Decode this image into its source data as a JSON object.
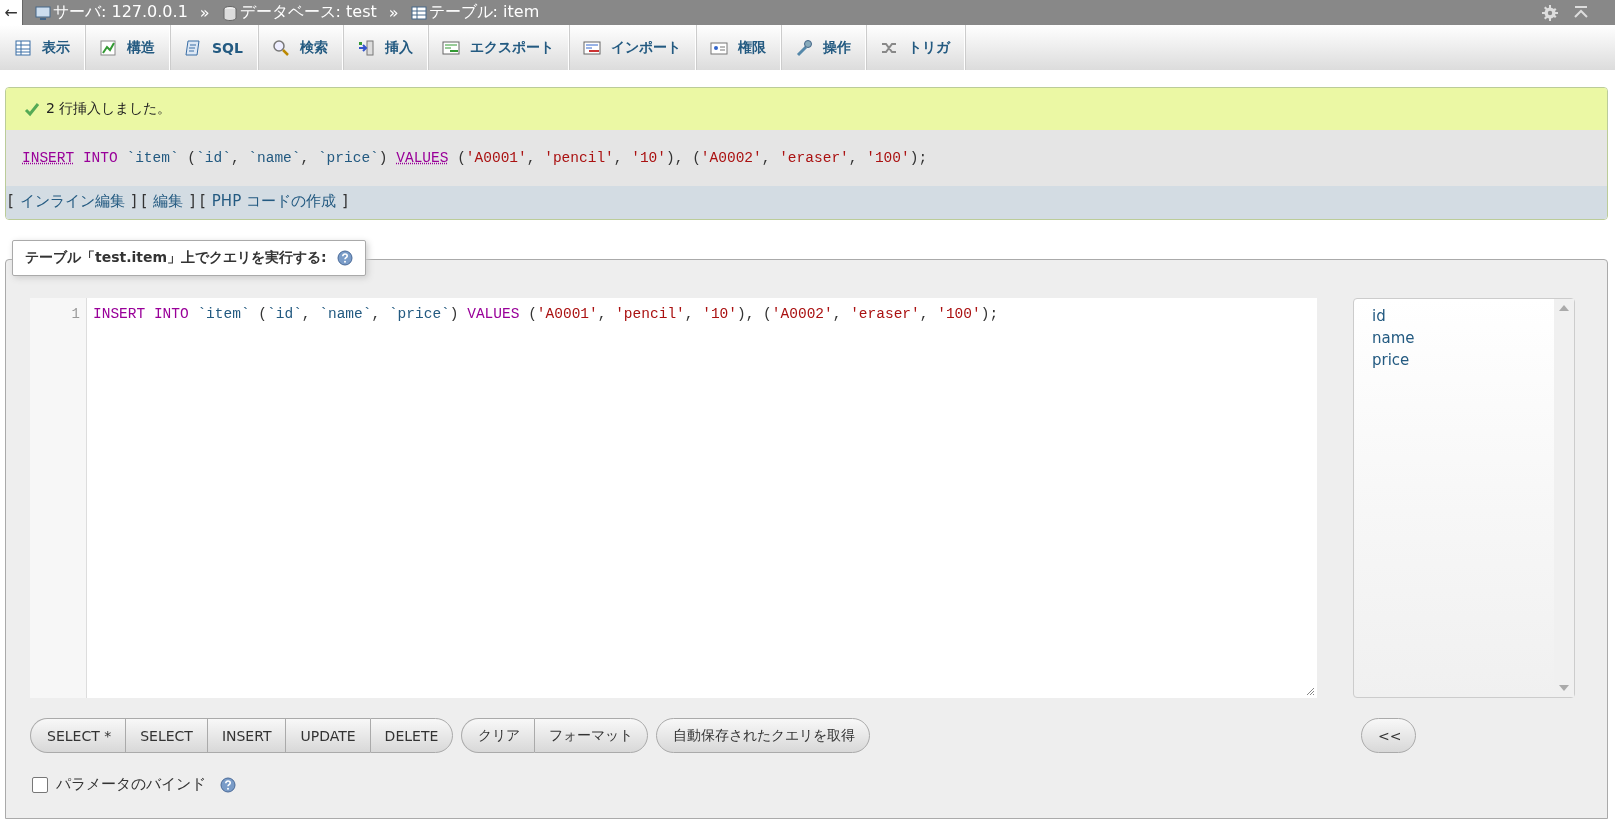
{
  "breadcrumb": {
    "back": "←",
    "items": [
      {
        "kind": "server",
        "text": "サーバ: 127.0.0.1"
      },
      {
        "kind": "database",
        "text": "データベース: test"
      },
      {
        "kind": "table",
        "text": "テーブル: item"
      }
    ],
    "separator": "»"
  },
  "tabs": [
    {
      "label": "表示",
      "selected": false
    },
    {
      "label": "構造",
      "selected": false
    },
    {
      "label": "SQL",
      "selected": false
    },
    {
      "label": "検索",
      "selected": false
    },
    {
      "label": "挿入",
      "selected": false
    },
    {
      "label": "エクスポート",
      "selected": false
    },
    {
      "label": "インポート",
      "selected": false
    },
    {
      "label": "権限",
      "selected": false
    },
    {
      "label": "操作",
      "selected": false
    },
    {
      "label": "トリガ",
      "selected": false
    }
  ],
  "message": {
    "text": "2 行挿入しました。",
    "sql": [
      {
        "kind": "doc",
        "text": "INSERT"
      },
      {
        "kind": "keyword",
        "text": " INTO "
      },
      {
        "kind": "ident",
        "text": "`item`"
      },
      {
        "kind": "punct",
        "text": " ("
      },
      {
        "kind": "ident",
        "text": "`id`"
      },
      {
        "kind": "punct",
        "text": ", "
      },
      {
        "kind": "ident",
        "text": "`name`"
      },
      {
        "kind": "punct",
        "text": ", "
      },
      {
        "kind": "ident",
        "text": "`price`"
      },
      {
        "kind": "punct",
        "text": ") "
      },
      {
        "kind": "doc",
        "text": "VALUES"
      },
      {
        "kind": "punct",
        "text": " ("
      },
      {
        "kind": "string",
        "text": "'A0001'"
      },
      {
        "kind": "punct",
        "text": ", "
      },
      {
        "kind": "string",
        "text": "'pencil'"
      },
      {
        "kind": "punct",
        "text": ", "
      },
      {
        "kind": "string",
        "text": "'10'"
      },
      {
        "kind": "punct",
        "text": "), ("
      },
      {
        "kind": "string",
        "text": "'A0002'"
      },
      {
        "kind": "punct",
        "text": ", "
      },
      {
        "kind": "string",
        "text": "'eraser'"
      },
      {
        "kind": "punct",
        "text": ", "
      },
      {
        "kind": "string",
        "text": "'100'"
      },
      {
        "kind": "punct",
        "text": ");"
      }
    ],
    "links": [
      {
        "kind": "bracket",
        "text": "["
      },
      {
        "kind": "link",
        "text": "インライン編集"
      },
      {
        "kind": "bracket",
        "text": "] ["
      },
      {
        "kind": "link",
        "text": "編集"
      },
      {
        "kind": "bracket",
        "text": "] ["
      },
      {
        "kind": "link",
        "text": "PHP コードの作成"
      },
      {
        "kind": "bracket",
        "text": "]"
      }
    ]
  },
  "query": {
    "legend": "テーブル「test.item」上でクエリを実行する:",
    "line_number": "1",
    "code": [
      {
        "kind": "keyword",
        "text": "INSERT INTO "
      },
      {
        "kind": "ident",
        "text": "`item`"
      },
      {
        "kind": "punct",
        "text": " ("
      },
      {
        "kind": "ident",
        "text": "`id`"
      },
      {
        "kind": "punct",
        "text": ", "
      },
      {
        "kind": "ident",
        "text": "`name`"
      },
      {
        "kind": "punct",
        "text": ", "
      },
      {
        "kind": "ident",
        "text": "`price`"
      },
      {
        "kind": "punct",
        "text": ") "
      },
      {
        "kind": "keyword",
        "text": "VALUES "
      },
      {
        "kind": "punct",
        "text": "("
      },
      {
        "kind": "string",
        "text": "'A0001'"
      },
      {
        "kind": "punct",
        "text": ", "
      },
      {
        "kind": "string",
        "text": "'pencil'"
      },
      {
        "kind": "punct",
        "text": ", "
      },
      {
        "kind": "string",
        "text": "'10'"
      },
      {
        "kind": "punct",
        "text": "), ("
      },
      {
        "kind": "string",
        "text": "'A0002'"
      },
      {
        "kind": "punct",
        "text": ", "
      },
      {
        "kind": "string",
        "text": "'eraser'"
      },
      {
        "kind": "punct",
        "text": ", "
      },
      {
        "kind": "string",
        "text": "'100'"
      },
      {
        "kind": "punct",
        "text": ");"
      }
    ],
    "columns": [
      "id",
      "name",
      "price"
    ],
    "button_groups": [
      [
        "SELECT *",
        "SELECT",
        "INSERT",
        "UPDATE",
        "DELETE"
      ],
      [
        "クリア",
        "フォーマット"
      ],
      [
        "自動保存されたクエリを取得"
      ]
    ],
    "insert_button": "<<",
    "bind_parameters": {
      "label": "パラメータのバインド",
      "checked": false
    }
  }
}
